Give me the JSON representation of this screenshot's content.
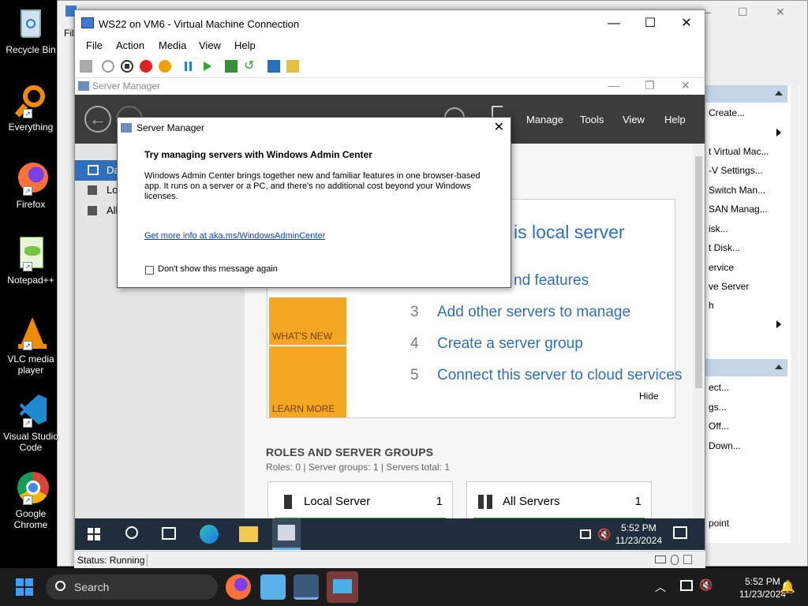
{
  "desktop": {
    "icons": [
      {
        "label": "Recycle Bin"
      },
      {
        "label": "Everything"
      },
      {
        "label": "Firefox"
      },
      {
        "label": "Notepad++"
      },
      {
        "label": "VLC media player"
      },
      {
        "label": "Visual Studio Code"
      },
      {
        "label": "Google Chrome"
      }
    ]
  },
  "host_panel": {
    "items": [
      "Create...",
      "t Virtual Mac...",
      "-V Settings...",
      "Switch Man...",
      "SAN Manag...",
      "isk...",
      "t Disk...",
      "ervice",
      "ve Server",
      "h",
      "ect...",
      "gs...",
      "Off...",
      "Down...",
      "point"
    ]
  },
  "vm_window": {
    "title": "WS22 on VM6 - Virtual Machine Connection",
    "menu": [
      "File",
      "Action",
      "Media",
      "View",
      "Help"
    ],
    "status": "Status: Running"
  },
  "server_manager": {
    "title": "Server Manager",
    "header_menu": [
      "Manage",
      "Tools",
      "View",
      "Help"
    ],
    "nav": [
      "Da",
      "Lo",
      "All"
    ],
    "quick_start_title": "is local server",
    "steps": [
      {
        "num": "",
        "text": "nd features"
      },
      {
        "num": "3",
        "text": "Add other servers to manage"
      },
      {
        "num": "4",
        "text": "Create a server group"
      },
      {
        "num": "5",
        "text": "Connect this server to cloud services"
      }
    ],
    "whats_new": "WHAT'S NEW",
    "learn_more": "LEARN MORE",
    "hide": "Hide",
    "roles_title": "ROLES AND SERVER GROUPS",
    "roles_summary": "Roles: 0   |   Server groups: 1   |   Servers total: 1",
    "tiles": [
      {
        "name": "Local Server",
        "count": "1"
      },
      {
        "name": "All Servers",
        "count": "1"
      }
    ],
    "taskbar_time": "5:52 PM",
    "taskbar_date": "11/23/2024"
  },
  "dialog": {
    "title": "Server Manager",
    "heading": "Try managing servers with Windows Admin Center",
    "body": "Windows Admin Center brings together new and familiar features in one browser-based app. It runs on a server or a PC, and there's no additional cost beyond your Windows licenses.",
    "link": "Get more info at aka.ms/WindowsAdminCenter",
    "checkbox_label": "Don't show this message again"
  },
  "taskbar": {
    "search_placeholder": "Search",
    "time": "5:52 PM",
    "date": "11/23/2024"
  },
  "colors": {
    "accent": "#2e6fbd",
    "orange": "#f5a623",
    "header_dark": "#3c3c3c"
  }
}
